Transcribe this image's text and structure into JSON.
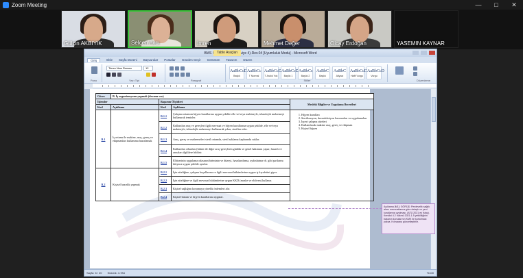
{
  "window": {
    "title": "Zoom Meeting"
  },
  "participants": [
    {
      "name": "Gülçin AKBIYIK",
      "bg": "#d9dde4",
      "skin": "#d7a98a",
      "hair": "#2b1d16",
      "cloth": "#2a2a2a"
    },
    {
      "name": "Selcen Avcı",
      "bg": "#8a8f73",
      "skin": "#dcb196",
      "hair": "#4a2c1a",
      "cloth": "#e8e4dc",
      "active": true
    },
    {
      "name": "İmren",
      "bg": "#d8d1c4",
      "skin": "#cf9b7b",
      "hair": "#1c1410",
      "cloth": "#1a1a1a"
    },
    {
      "name": "Mehmet Değer",
      "bg": "#b9ab98",
      "skin": "#c98f6c",
      "hair": "#1a120e",
      "cloth": "#2c2f44"
    },
    {
      "name": "Olcay Erdoğan",
      "bg": "#c9c9c4",
      "skin": "#d5a587",
      "hair": "#3b2418",
      "cloth": "#3b3b3b"
    },
    {
      "name": "YASEMIN KAYNAR",
      "bg": "#111111",
      "skin": "#111111",
      "hair": "#111111",
      "cloth": "#111111"
    }
  ],
  "word": {
    "tool_tab": "Tablo Araçları",
    "title": "BMS Sıhhi Kurdima (Seviye 4)-Rev.04 [Uyumluluk Modu] - Microsoft Word",
    "tabs": [
      "Giriş",
      "Ekle",
      "Sayfa Düzeni",
      "Başvurular",
      "Postalar",
      "Gözden Geçir",
      "Görünüm",
      "Tasarım",
      "Düzen"
    ],
    "active_tab": "Giriş",
    "font_name": "Times New Roman",
    "font_size": "12",
    "groups": [
      "Pano",
      "Yazı Tipi",
      "Paragraf",
      "Stiller",
      "Düzenleme"
    ],
    "styles": [
      {
        "preview": "AaBbCcDd",
        "label": "Başlık"
      },
      {
        "preview": "AaBbCc",
        "label": "T Normal"
      },
      {
        "preview": "AaBbCcDd",
        "label": "T Aralık Yok"
      },
      {
        "preview": "AaBbCcDd",
        "label": "Başlık 1"
      },
      {
        "preview": "AaBbCc",
        "label": "Başlık 2"
      },
      {
        "preview": "AaBbC",
        "label": "Başlık"
      },
      {
        "preview": "AaBbC",
        "label": "Altyazı"
      },
      {
        "preview": "AaBbCcDd",
        "label": "Hafif Vurgu"
      },
      {
        "preview": "AaBbCcD",
        "label": "Vurgu"
      }
    ],
    "status": {
      "page": "Sayfa: 6 / 20",
      "words": "Sözcük: 4.784",
      "zoom": "%100"
    }
  },
  "doc": {
    "gorev_label": "Görev",
    "gorev_value": "B. İş organizasyonu yapmak (devamı var)",
    "col_islemler": "İşlemler",
    "col_basarim": "Başarım Ölçütleri",
    "col_meslek": "Mesleki Bilgiler ve Uygulama Becerileri",
    "col_kod": "Kod",
    "col_aciklama": "Açıklama",
    "rows": [
      {
        "code": "B.1",
        "desc": "İş ortamı ile makine, araç, gereç ve ekipmanları kullanıma hazırlamak",
        "criteria": [
          {
            "code": "B.1.1",
            "text": "Çalışma ortamını hijyen kurallarına uygun şekilde elle ve/veya makineyle, teknolojik malzemeyi kullanarak temizler."
          },
          {
            "code": "B.1.2",
            "text": "Kullanılan araç ve gereçleri ilgili mevzuat ve hijyen kurallarına uygun şekilde, elle ve/veya makineyle, teknolojik malzemeyi kullanarak yıkar, sterilize eder."
          },
          {
            "code": "B.1.3",
            "text": "Araç, gereç ve malzemeleri steril ortamda, steril saklama kaplarında saklar."
          },
          {
            "code": "B.1.4",
            "text": "Kullanılan cihazları (bitimi ile diğer araç-gereçlerin günlük ve genel bakımını yapar, hasarlı ve arızaları ilgililere bildirir."
          },
          {
            "code": "B.1.5",
            "text": "Elbisesinin uygulama odasının/biriminin ve düzeyi, havalandırma, aydınlatma vb. gibi şartlarını ihtiyaca uygun şekilde ayarlar."
          }
        ]
      },
      {
        "code": "B.2",
        "desc": "Kişisel hazırlık yapmak",
        "criteria": [
          {
            "code": "B.2.1",
            "text": "İşin niteliğine, çalışma koşullarına ve ilgili mevzuat hükümlerine uygun iş kıyafetini giyer."
          },
          {
            "code": "B.2.2",
            "text": "İşin niteliğine ve ilgili mevzuat hükümlerine uygun KKD (maske ve eldiven) kullanır."
          },
          {
            "code": "B.2.3",
            "text": "Kişisel sağlığını korumaya yönelik önlemleri alır."
          },
          {
            "code": "B.2.4",
            "text": "Kişisel bakım ve hijyen kurallarına uygular."
          }
        ]
      }
    ],
    "skills": [
      "Hijyen kuralları",
      "Sterilizasyon, dezenfeksiyon kavramları ve uygulamaları",
      "İşyeri çalışma süreleri",
      "Kullanılacak makine araç, gereç ve ekipman",
      "Kişisel hijyen"
    ],
    "comment": "Açıklama [M1]: GÖRÜŞ: Perdevelik sağlık alanı mevzuatlarına göre detaylı ve yeni kurallarına uyulması. (ATÜ 2021 ek İstaç). Kendisi 4.2 hükmü 2021-1.5 yetkililiğinin bakanın konularının KMK ile kurtulması yoksa. Kılınacası güncelleştirilir."
  }
}
